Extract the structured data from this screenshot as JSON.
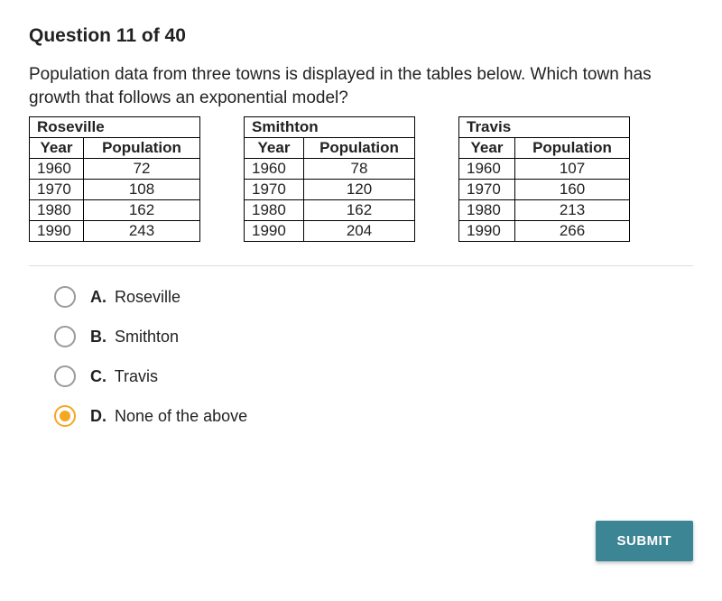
{
  "question": {
    "title": "Question 11 of 40",
    "prompt": "Population data from three towns is displayed in the tables below. Which town has growth that follows an exponential model?"
  },
  "tables": [
    {
      "town": "Roseville",
      "headers": [
        "Year",
        "Population"
      ],
      "rows": [
        [
          "1960",
          "72"
        ],
        [
          "1970",
          "108"
        ],
        [
          "1980",
          "162"
        ],
        [
          "1990",
          "243"
        ]
      ]
    },
    {
      "town": "Smithton",
      "headers": [
        "Year",
        "Population"
      ],
      "rows": [
        [
          "1960",
          "78"
        ],
        [
          "1970",
          "120"
        ],
        [
          "1980",
          "162"
        ],
        [
          "1990",
          "204"
        ]
      ]
    },
    {
      "town": "Travis",
      "headers": [
        "Year",
        "Population"
      ],
      "rows": [
        [
          "1960",
          "107"
        ],
        [
          "1970",
          "160"
        ],
        [
          "1980",
          "213"
        ],
        [
          "1990",
          "266"
        ]
      ]
    }
  ],
  "options": [
    {
      "letter": "A.",
      "text": "Roseville",
      "selected": false
    },
    {
      "letter": "B.",
      "text": "Smithton",
      "selected": false
    },
    {
      "letter": "C.",
      "text": "Travis",
      "selected": false
    },
    {
      "letter": "D.",
      "text": "None of the above",
      "selected": true
    }
  ],
  "submit_label": "SUBMIT"
}
